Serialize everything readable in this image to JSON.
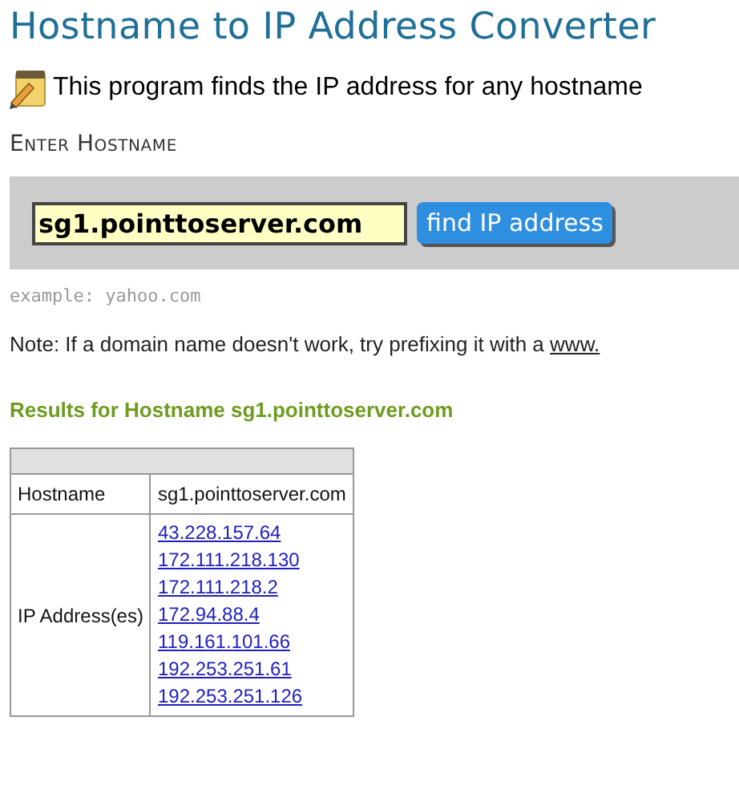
{
  "title": "Hostname to IP Address Converter",
  "intro": "This program finds the IP address for any hostname",
  "section_label": "Enter Hostname",
  "form": {
    "value": "sg1.pointtoserver.com",
    "button": "find IP address"
  },
  "example": "example: yahoo.com",
  "note": {
    "text": "Note: If a domain name doesn't work, try prefixing it with a",
    "link": "www."
  },
  "results_title": "Results for Hostname sg1.pointtoserver.com",
  "table": {
    "rows": [
      {
        "label": "Hostname",
        "values": [
          "sg1.pointtoserver.com"
        ],
        "kind": "text"
      },
      {
        "label": "IP Address(es)",
        "values": [
          "43.228.157.64",
          "172.111.218.130",
          "172.111.218.2",
          "172.94.88.4",
          "119.161.101.66",
          "192.253.251.61",
          "192.253.251.126"
        ],
        "kind": "links"
      }
    ]
  }
}
